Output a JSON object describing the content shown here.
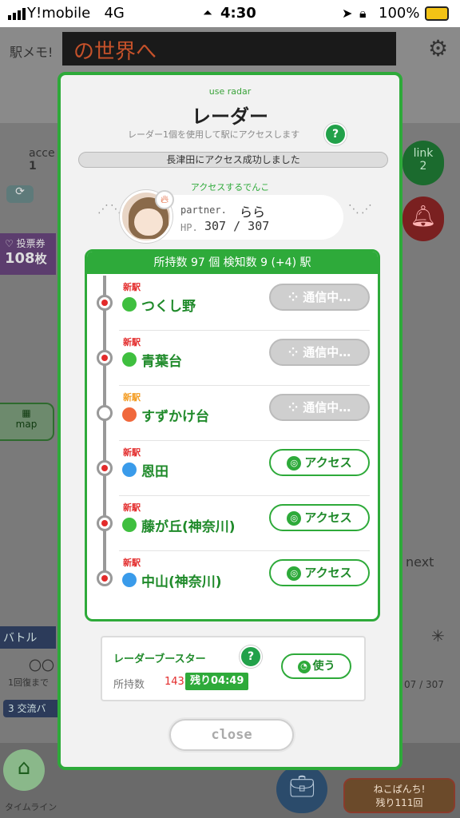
{
  "status_bar": {
    "carrier": "Y!mobile",
    "network": "4G",
    "time": "4:30",
    "battery": "100%"
  },
  "background": {
    "header_app": "駅メモ!",
    "marquee": "の世界へ",
    "access_label": "acce",
    "access_count": "1",
    "link_label": "link",
    "link_count": "2",
    "vote_label": "投票券",
    "vote_count": "108",
    "vote_unit": "枚",
    "map_label": "map",
    "next_label": "next",
    "battle_label": "バトル",
    "circles": "〇〇",
    "recover_text": "1回復まで",
    "hp_text": "07 / 307",
    "event_banner": "3 交流バ",
    "timeline_label": "タイムライン",
    "nekopanchi_label": "ねこぱんち!",
    "nekopanchi_remaining": "残り111回"
  },
  "modal": {
    "subtitle": "use radar",
    "title": "レーダー",
    "description": "レーダー1個を使用して駅にアクセスします",
    "status_message": "長津田にアクセス成功しました",
    "partner_section_label": "アクセスするでんこ",
    "partner": {
      "name_key": "partner.",
      "name": "らら",
      "hp_key": "HP.",
      "hp": "307 / 307"
    },
    "list_header": "所持数 97 個 検知数 9 (+4) 駅",
    "stations": [
      {
        "badge": "新駅",
        "badge_color": "#e32b2b",
        "name": "つくし野",
        "attr_color": "#3fbf3f",
        "dot": "red",
        "action": "通信中…",
        "action_type": "pending"
      },
      {
        "badge": "新駅",
        "badge_color": "#e32b2b",
        "name": "青葉台",
        "attr_color": "#3fbf3f",
        "dot": "red",
        "action": "通信中…",
        "action_type": "pending"
      },
      {
        "badge": "新駅",
        "badge_color": "#f39a1e",
        "name": "すずかけ台",
        "attr_color": "#f0683c",
        "dot": "empty",
        "action": "通信中…",
        "action_type": "pending"
      },
      {
        "badge": "新駅",
        "badge_color": "#e32b2b",
        "name": "恩田",
        "attr_color": "#3a9bea",
        "dot": "red",
        "action": "アクセス",
        "action_type": "access"
      },
      {
        "badge": "新駅",
        "badge_color": "#e32b2b",
        "name": "藤が丘(神奈川)",
        "attr_color": "#3fbf3f",
        "dot": "red",
        "action": "アクセス",
        "action_type": "access"
      },
      {
        "badge": "新駅",
        "badge_color": "#e32b2b",
        "name": "中山(神奈川)",
        "attr_color": "#3a9bea",
        "dot": "red",
        "action": "アクセス",
        "action_type": "access"
      }
    ],
    "booster": {
      "title": "レーダーブースター",
      "owned_key": "所持数",
      "owned": "143",
      "timer": "残り04:49",
      "use_label": "使う"
    },
    "close_label": "close",
    "help_glyph": "?"
  }
}
